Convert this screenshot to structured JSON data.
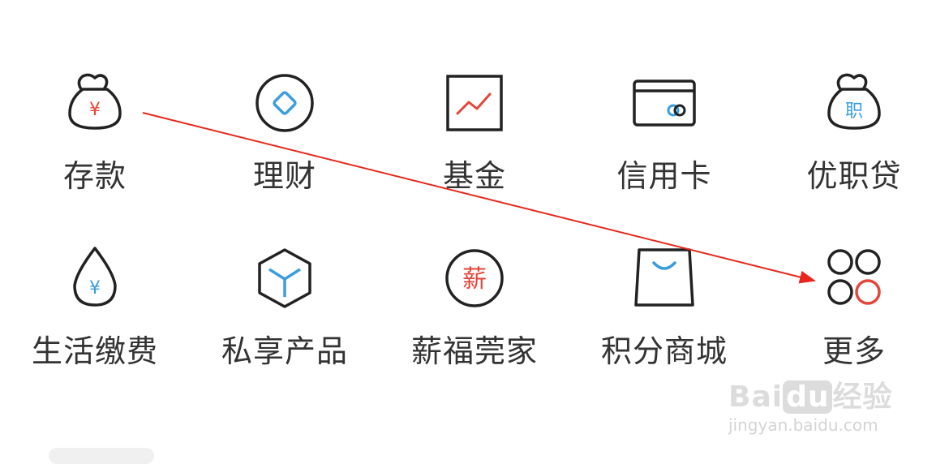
{
  "menu": {
    "items": [
      {
        "label": "存款",
        "icon": "money-bag-yuan-icon"
      },
      {
        "label": "理财",
        "icon": "diamond-circle-icon"
      },
      {
        "label": "基金",
        "icon": "chart-trend-icon"
      },
      {
        "label": "信用卡",
        "icon": "credit-card-icon"
      },
      {
        "label": "优职贷",
        "icon": "money-bag-job-icon"
      },
      {
        "label": "生活缴费",
        "icon": "water-drop-yuan-icon"
      },
      {
        "label": "私享产品",
        "icon": "cube-icon"
      },
      {
        "label": "薪福莞家",
        "icon": "salary-circle-icon"
      },
      {
        "label": "积分商城",
        "icon": "shopping-bag-icon"
      },
      {
        "label": "更多",
        "icon": "more-circles-icon"
      }
    ],
    "icon_glyphs": {
      "yuan": "¥",
      "job": "职",
      "salary": "薪"
    }
  },
  "watermark": {
    "logo_text_1": "Bai",
    "logo_text_2": "du",
    "logo_text_3": "经验",
    "url": "jingyan.baidu.com"
  },
  "colors": {
    "accent_red": "#e4463b",
    "accent_blue": "#3a9de0",
    "stroke": "#222222",
    "label": "#333333",
    "arrow": "#e8261c"
  }
}
